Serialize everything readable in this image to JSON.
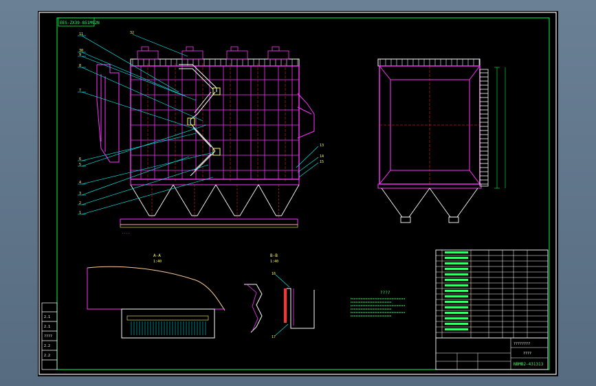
{
  "drawing": {
    "top_left_code": "EES-ZX39-851M92N",
    "section_aa": {
      "name": "A-A",
      "scale": "1:40"
    },
    "section_bb": {
      "name": "B-B",
      "scale": "1:40"
    },
    "note_mark": "????",
    "callouts_left": [
      "11",
      "30",
      "9",
      "8",
      "7",
      "6",
      "5",
      "4",
      "3",
      "2",
      "1"
    ],
    "callouts_top": [
      "32"
    ],
    "callouts_right": [
      "13",
      "14",
      "15"
    ],
    "callouts_detail": [
      "16",
      "17"
    ],
    "drawing_number": "NBMB2-431313",
    "title_block": {
      "line1": "????????",
      "line2": "????",
      "right_marks": [
        "????",
        "????",
        "????"
      ]
    },
    "revision_labels": [
      "2.1",
      "2.1",
      "????",
      "2.2",
      "2.2"
    ]
  },
  "colors": {
    "background": "#000000",
    "frame": "#ffffff",
    "inner_frame": "#00ff44",
    "structure": "#ff33ff",
    "leader": "#00ffff",
    "center_line": "#ff3333",
    "table": "#ffffff",
    "text_green": "#33ff66",
    "yellow": "#ffff66"
  }
}
